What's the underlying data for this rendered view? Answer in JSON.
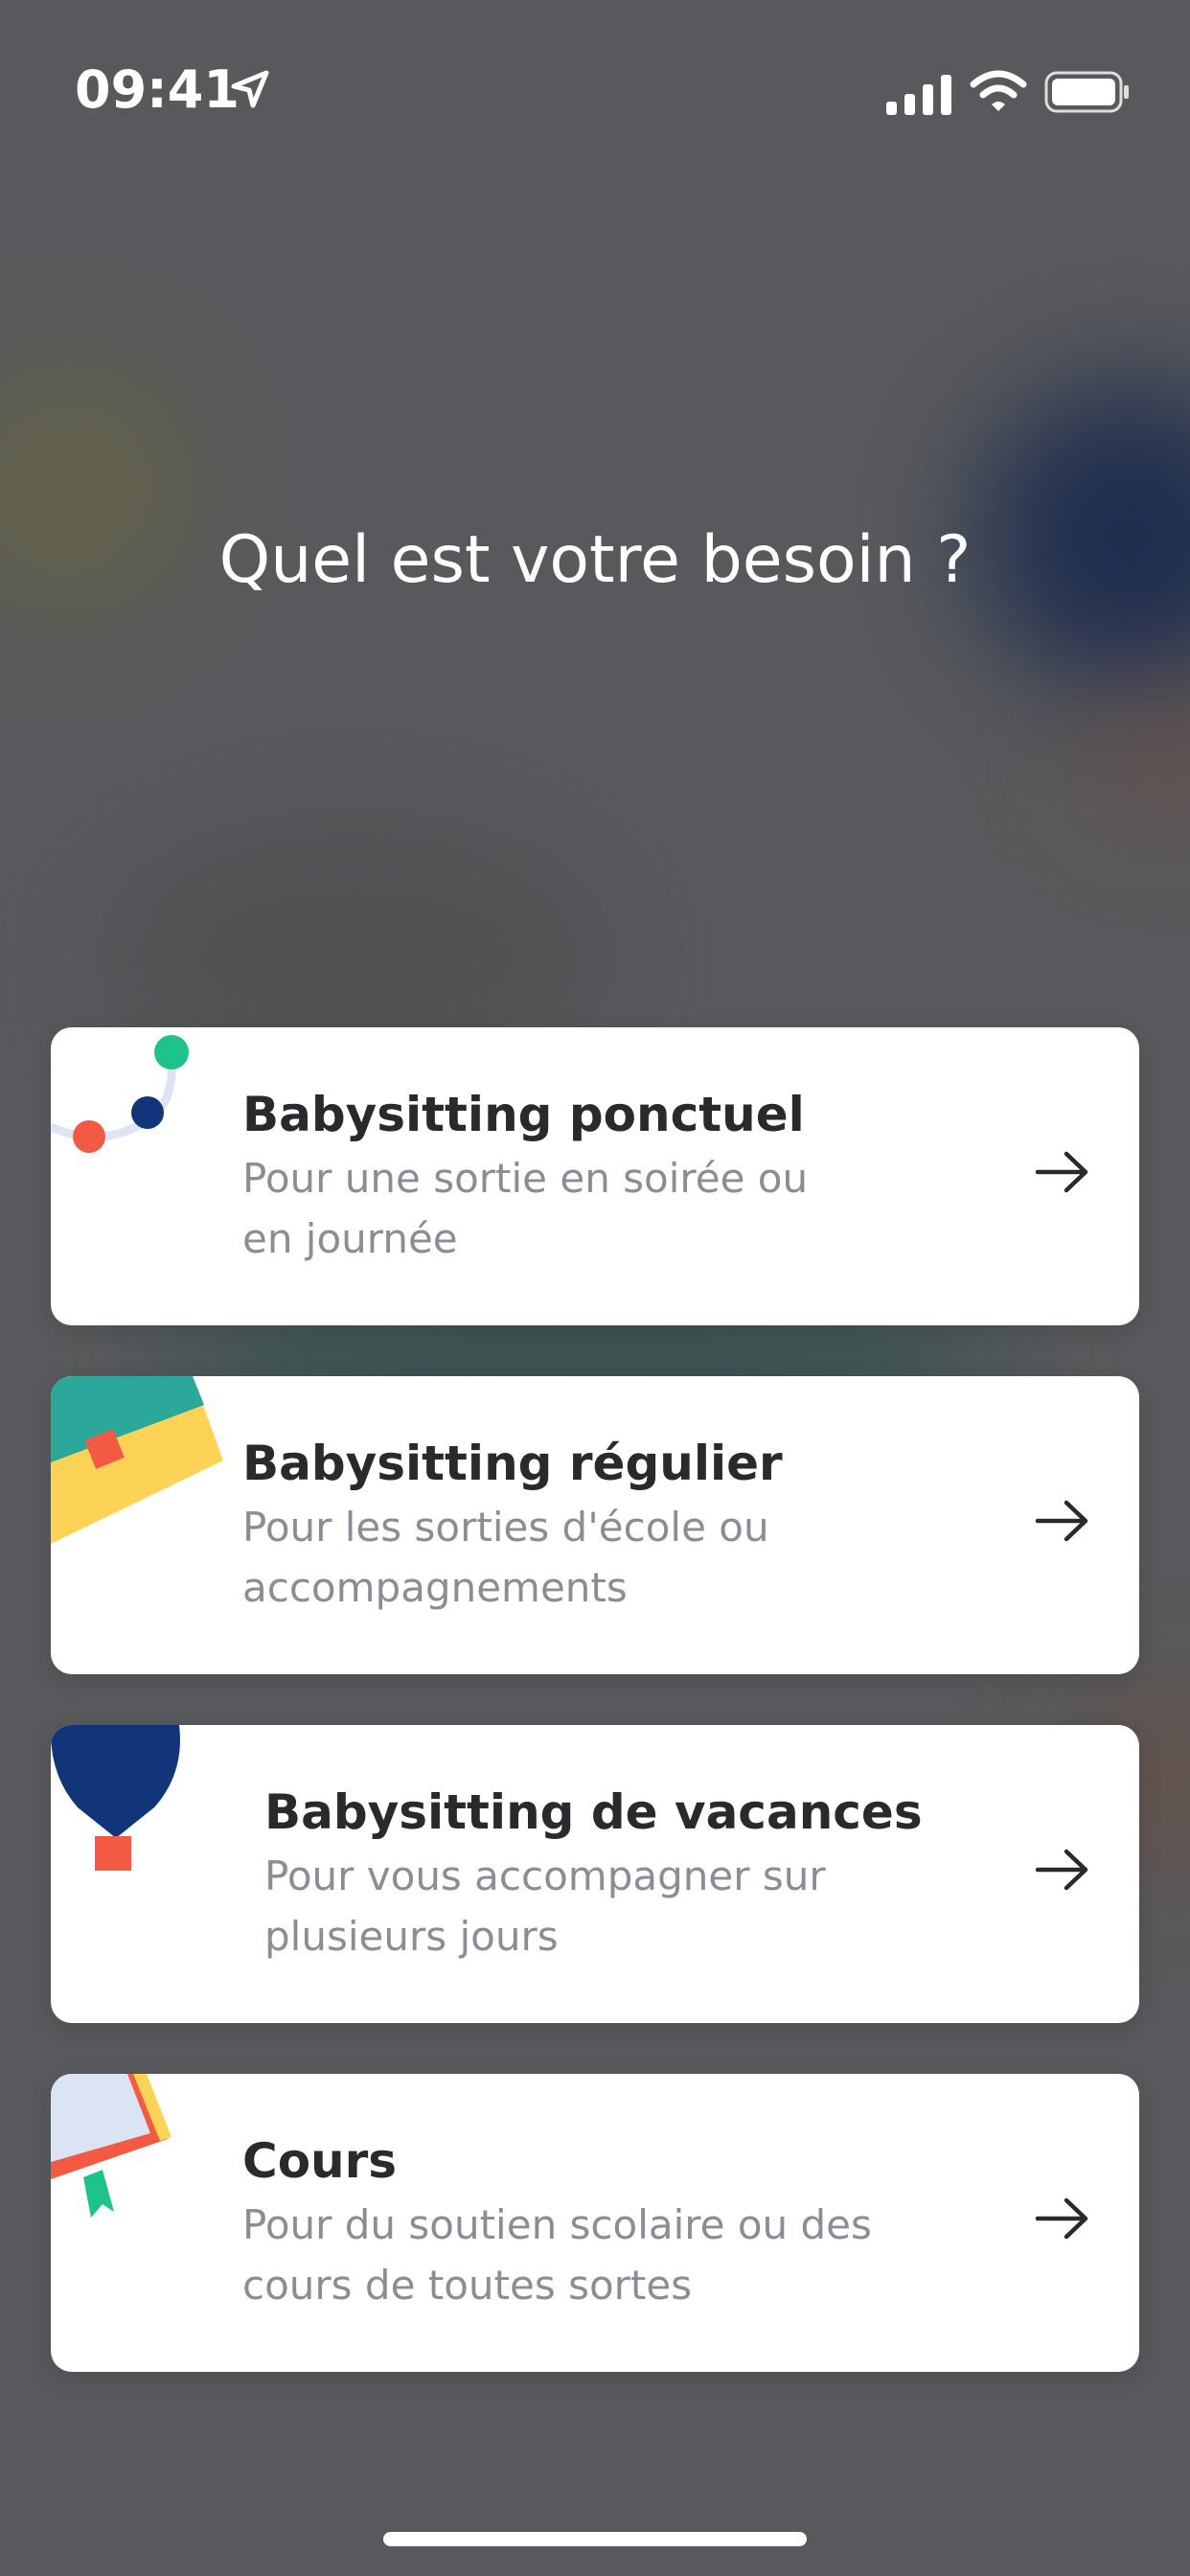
{
  "status_bar": {
    "time": "09:41",
    "icons": [
      "location-arrow-icon",
      "cellular-signal-icon",
      "wifi-icon",
      "battery-icon"
    ]
  },
  "page": {
    "title": "Quel est votre besoin ?"
  },
  "options": [
    {
      "title": "Babysitting ponctuel",
      "description_line1": "Pour une sortie en soirée ou",
      "description_line2": "en journée",
      "icon": "dots-timeline-icon",
      "arrow": "arrow-right-icon"
    },
    {
      "title": "Babysitting régulier",
      "description_line1": "Pour les sorties d'école ou",
      "description_line2": "accompagnements",
      "icon": "calendar-icon",
      "arrow": "arrow-right-icon"
    },
    {
      "title": "Babysitting de vacances",
      "description_line1": "Pour vous accompagner sur",
      "description_line2": "plusieurs jours",
      "icon": "hot-air-balloon-icon",
      "arrow": "arrow-right-icon"
    },
    {
      "title": "Cours",
      "description_line1": "Pour du soutien scolaire ou des",
      "description_line2": "cours de toutes sortes",
      "icon": "book-icon",
      "arrow": "arrow-right-icon"
    }
  ],
  "colors": {
    "overlay": "#58595c",
    "card_background": "#ffffff",
    "title_text": "#2a2a2e",
    "description_text": "#8a8d96",
    "accent_red": "#f25a43",
    "accent_navy": "#123478",
    "accent_green": "#1ec28b",
    "accent_teal": "#2ba89a",
    "accent_yellow": "#fdd357"
  }
}
